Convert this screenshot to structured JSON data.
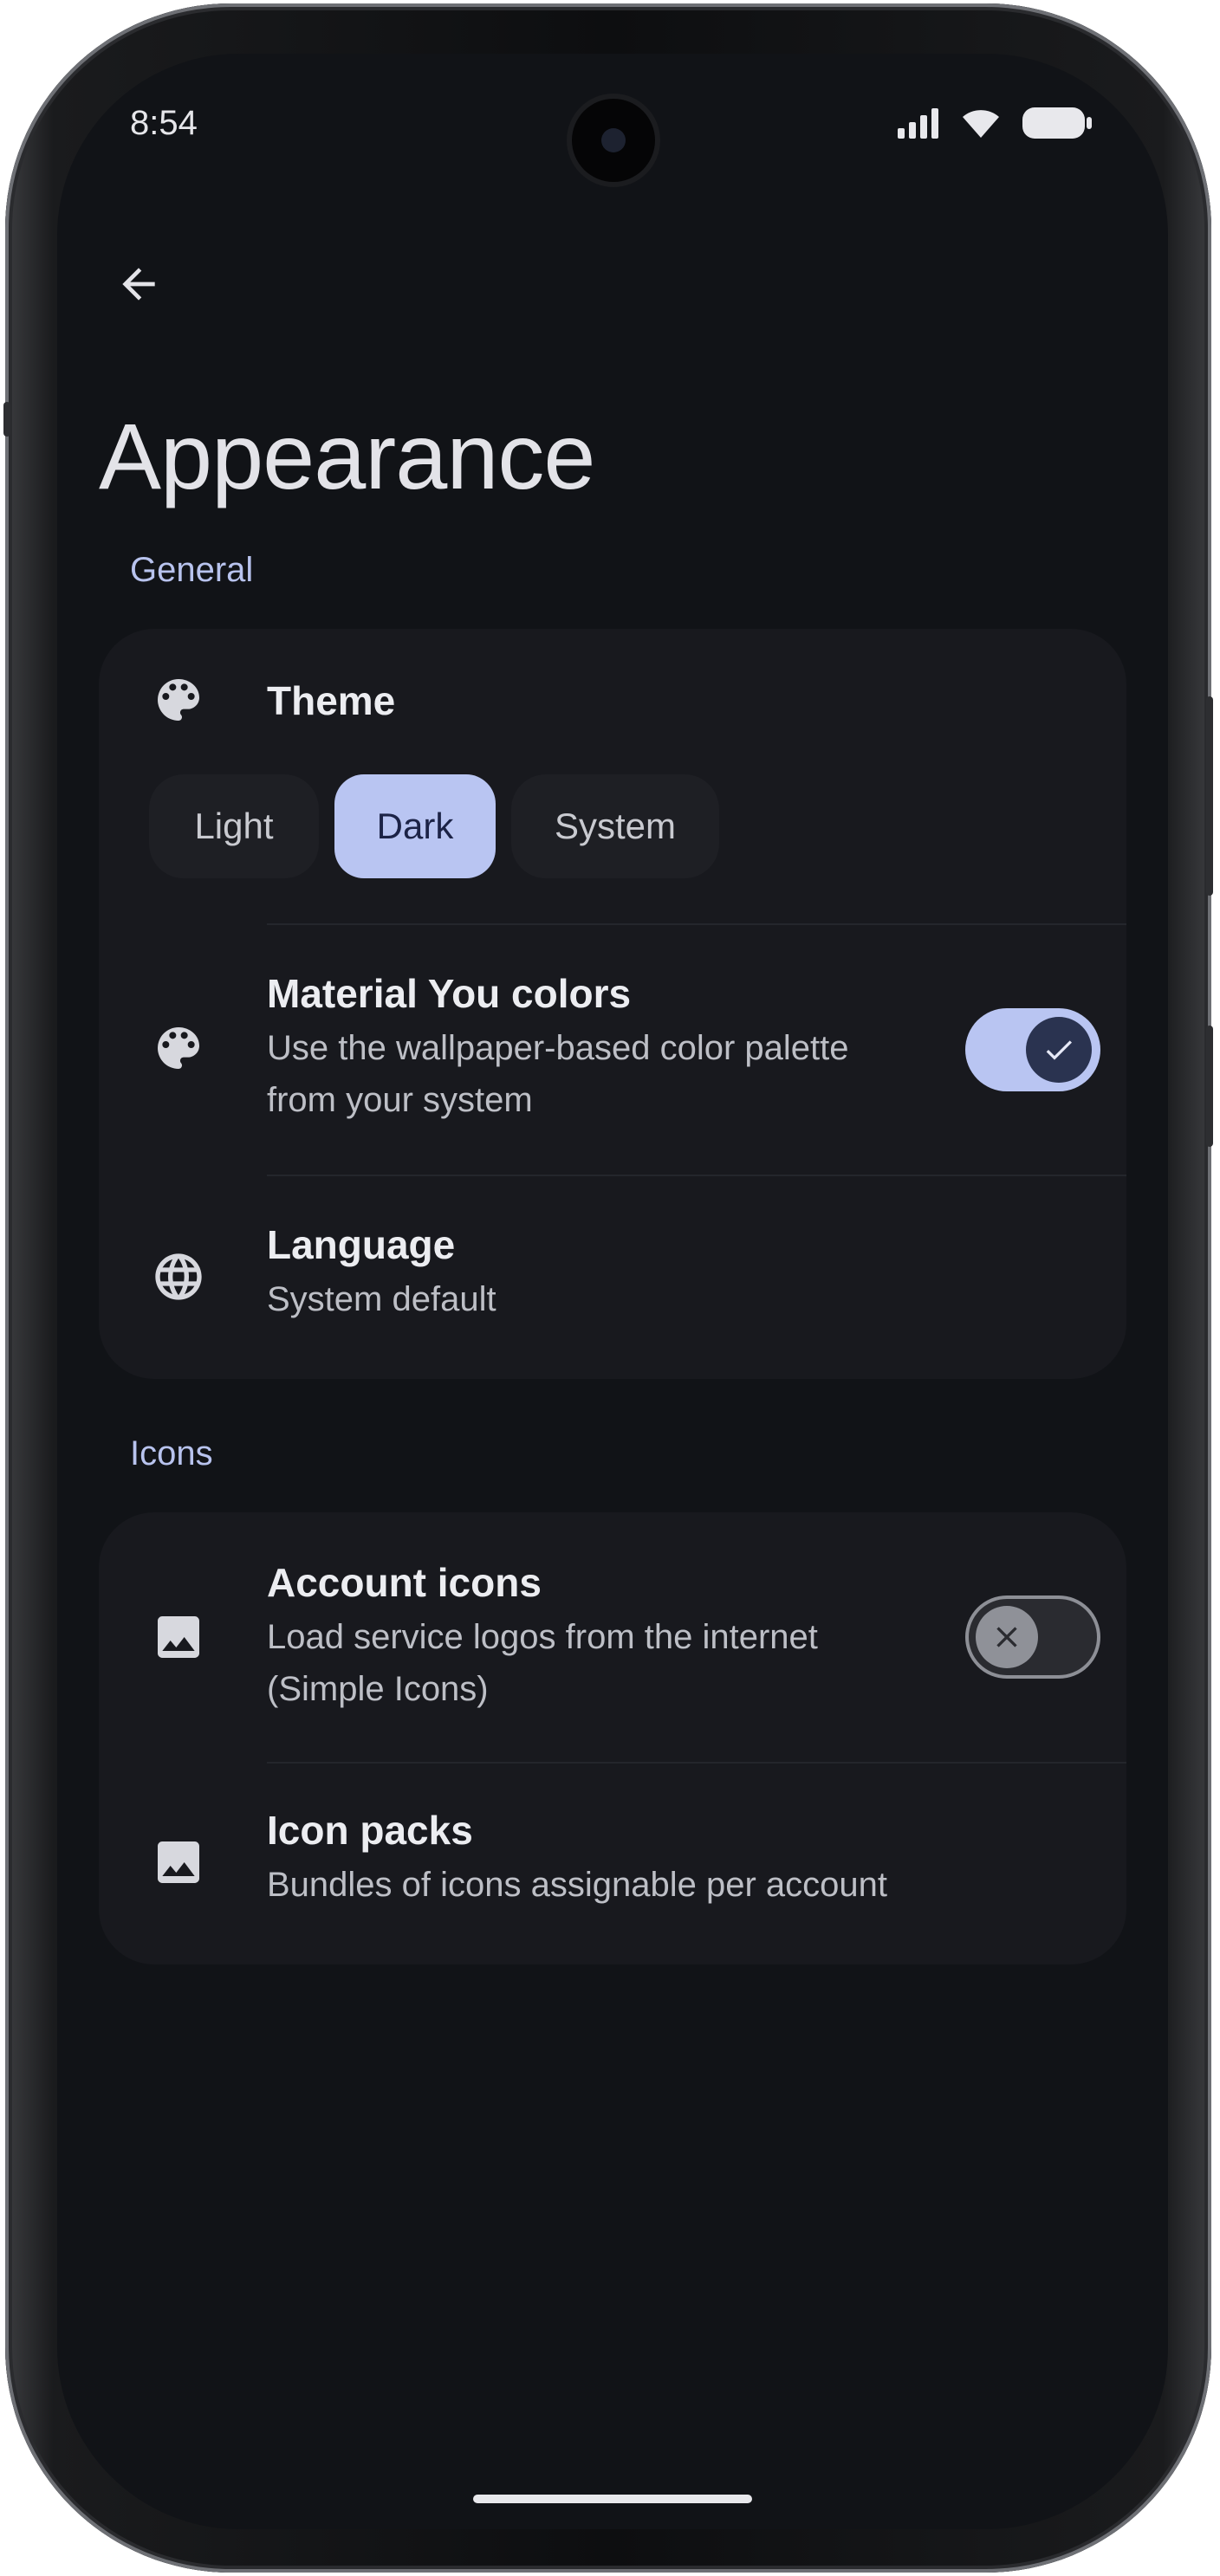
{
  "status": {
    "time": "8:54"
  },
  "header": {
    "title": "Appearance"
  },
  "general": {
    "label": "General",
    "theme": {
      "title": "Theme",
      "options": [
        "Light",
        "Dark",
        "System"
      ],
      "selected": "Dark"
    },
    "material_you": {
      "title": "Material You colors",
      "subtitle_line1": "Use the wallpaper-based color palette",
      "subtitle_line2": "from your system",
      "enabled": true
    },
    "language": {
      "title": "Language",
      "subtitle": "System default"
    }
  },
  "icons": {
    "label": "Icons",
    "account_icons": {
      "title": "Account icons",
      "subtitle_line1": "Load service logos from the internet",
      "subtitle_line2": "(Simple Icons)",
      "enabled": false
    },
    "icon_packs": {
      "title": "Icon packs",
      "subtitle": "Bundles of icons assignable per account"
    }
  },
  "colors": {
    "background": "#111317",
    "card": "#18191e",
    "accent": "#b9c5f2",
    "section_label": "#b8c3ee"
  },
  "icon_names": [
    "back-arrow-icon",
    "palette-icon",
    "globe-icon",
    "image-icon",
    "check-icon",
    "close-icon",
    "signal-icon",
    "wifi-icon",
    "battery-icon"
  ]
}
